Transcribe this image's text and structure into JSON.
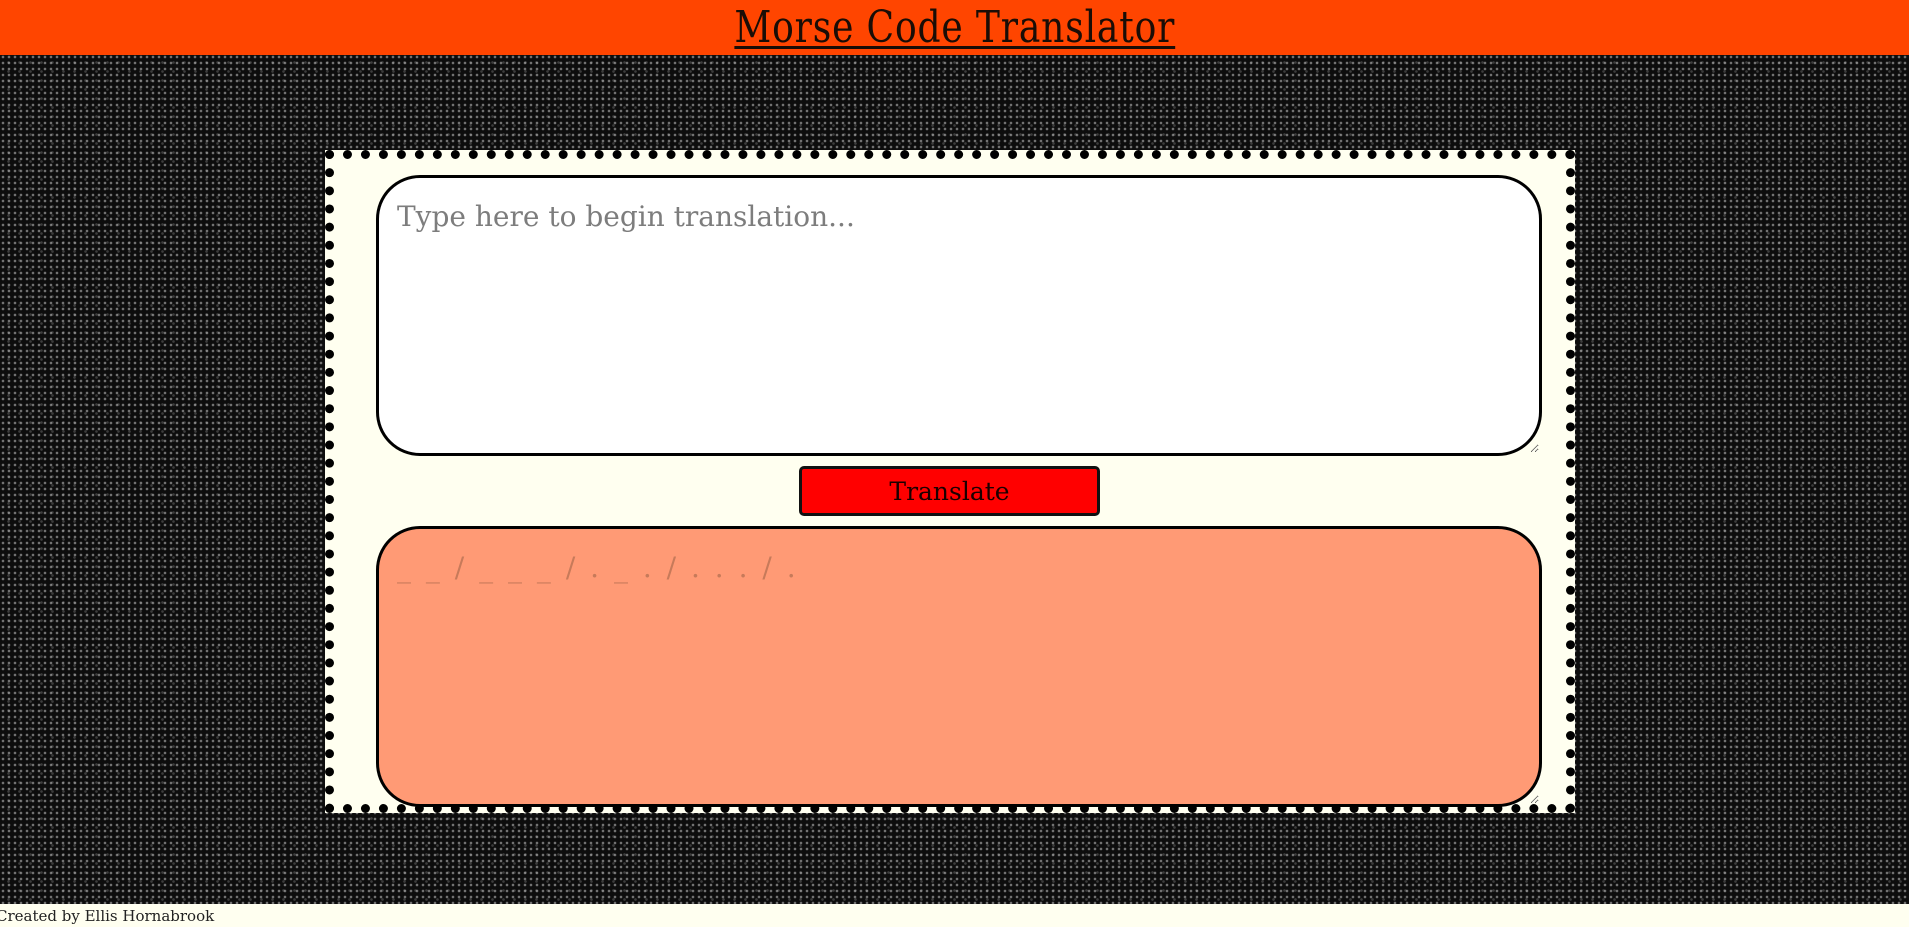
{
  "header": {
    "title": "Morse Code Translator"
  },
  "translator": {
    "input_placeholder": "Type here to begin translation...",
    "input_value": "",
    "translate_label": "Translate",
    "output_placeholder": "_ _ / _ _ _ / . _ . / . . . / .",
    "output_value": ""
  },
  "footer": {
    "credit": "Created by Ellis Hornabrook"
  },
  "colors": {
    "header": "#ff4500",
    "panel": "#fffff0",
    "button": "#ff0000",
    "output": "#ff9a75"
  }
}
